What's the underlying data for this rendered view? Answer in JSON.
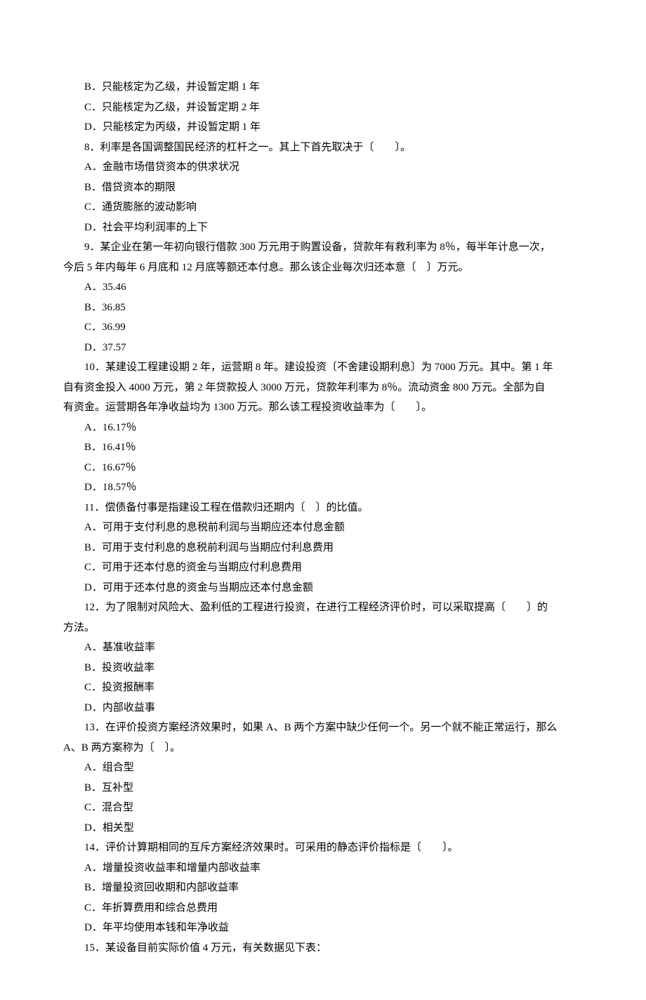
{
  "lines": [
    "B．只能核定为乙级，并设暂定期 1 年",
    "C．只能核定为乙级，并设暂定期 2 年",
    "D．只能核定为丙级，并设暂定期 1 年",
    "8．利率是各国调整国民经济的杠杆之一。其上下首先取决于〔　　〕。",
    "A．金融市场借贷资本的供求状况",
    "B．借贷资本的期限",
    "C．通货膨胀的波动影响",
    "D．社会平均利润率的上下",
    "9．某企业在第一年初向银行借款 300 万元用于购置设备，贷款年有救利率为 8％，每半年计息一次，",
    "今后 5 年内每年 6 月底和 12 月底等额还本付息。那么该企业每次归还本意〔　〕万元。",
    "A．35.46",
    "B．36.85",
    "C．36.99",
    "D．37.57",
    "10．某建设工程建设期 2 年，运营期 8 年。建设投资〔不舍建设期利息〕为 7000 万元。其中。第 1 年",
    "自有资金投入 4000 万元，第 2 年贷款投人 3000 万元，贷款年利率为 8％。流动资金 800 万元。全部为自",
    "有资金。运营期各年净收益均为 1300 万元。那么该工程投资收益率为〔　　〕。",
    "A．16.17％",
    "B．16.41％",
    "C．16.67％",
    "D．18.57％",
    "11．偿债备付事是指建设工程在借款归还期内〔　〕的比值。",
    "A．可用于支付利息的息税前利润与当期应还本付息金额",
    "B．可用于支付利息的息税前利润与当期应付利息费用",
    "C．可用于还本付息的资金与当期应付利息费用",
    "D．可用于还本付息的资金与当期应还本付息金额",
    "12．为了限制对风险大、盈利低的工程进行投资，在进行工程经济评价时，可以采取提高〔　　〕的",
    "方法。",
    "A．基准收益率",
    "B．投资收益率",
    "C．投资报酬率",
    "D．内部收益事",
    "13．在评价投资方案经济效果时，如果 A、B 两个方案中缺少任何一个。另一个就不能正常运行，那么",
    "A、B 两方案称为〔　〕。",
    "A．组合型",
    "B．互补型",
    "C．混合型",
    "D．相关型",
    "14．评价计算期相同的互斥方案经济效果时。可采用的静态评价指标是〔　　〕。",
    "A．增量投资收益率和增量内部收益率",
    "B．增量投资回收期和内部收益率",
    "C．年折算费用和综合总费用",
    "D．年平均使用本钱和年净收益",
    "15．某设备目前实际价值 4 万元，有关数据见下表："
  ],
  "indents": [
    "opt",
    "opt",
    "opt",
    "q",
    "opt",
    "opt",
    "opt",
    "opt",
    "q",
    "no",
    "opt",
    "opt",
    "opt",
    "opt",
    "q",
    "no",
    "no",
    "opt",
    "opt",
    "opt",
    "opt",
    "q",
    "opt",
    "opt",
    "opt",
    "opt",
    "q",
    "no",
    "opt",
    "opt",
    "opt",
    "opt",
    "q",
    "no",
    "opt",
    "opt",
    "opt",
    "opt",
    "q",
    "opt",
    "opt",
    "opt",
    "opt",
    "q"
  ]
}
